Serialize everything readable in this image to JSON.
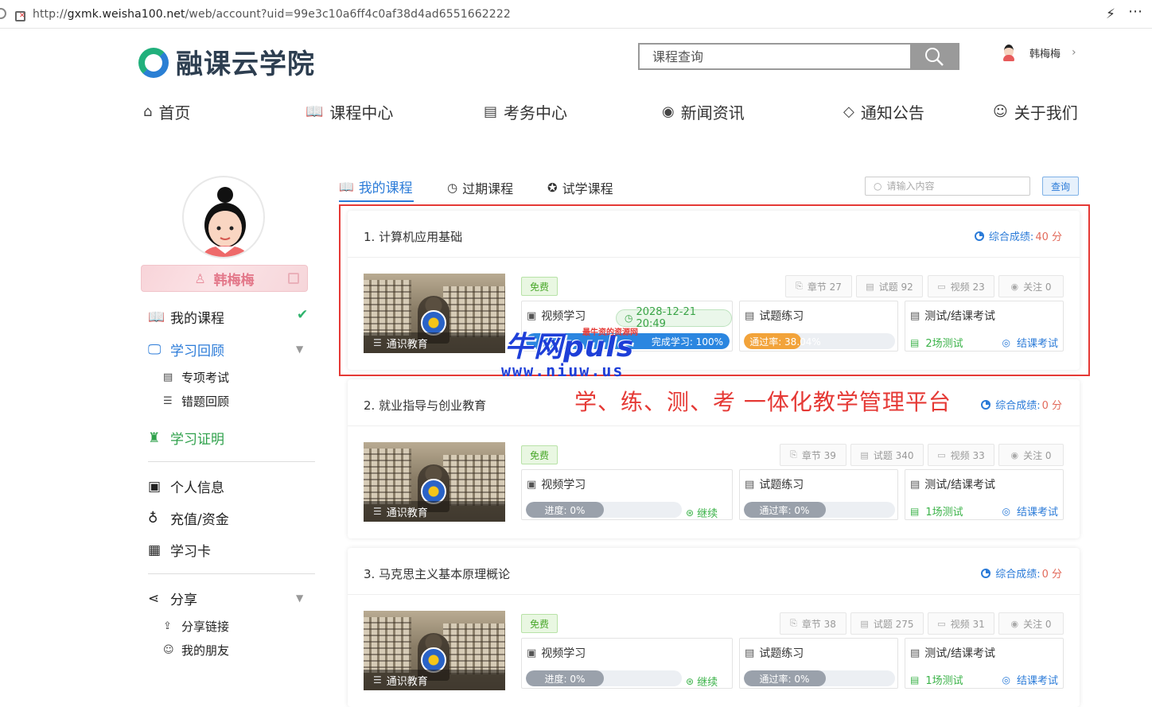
{
  "address_bar": {
    "url_prefix": "http://",
    "url_host": "gxmk.weisha100.net",
    "url_path": "/web/account?uid=99e3c10a6ff4c0af38d4ad6551662222"
  },
  "header": {
    "logo_text": "融课云学院",
    "search_placeholder": "课程查询",
    "user_name": "韩梅梅"
  },
  "nav": [
    {
      "label": "首页",
      "icon": "home-icon"
    },
    {
      "label": "课程中心",
      "icon": "book-icon"
    },
    {
      "label": "考务中心",
      "icon": "exam-icon"
    },
    {
      "label": "新闻资讯",
      "icon": "news-icon"
    },
    {
      "label": "通知公告",
      "icon": "tag-icon"
    },
    {
      "label": "关于我们",
      "icon": "users-icon"
    }
  ],
  "sidebar": {
    "user_name": "韩梅梅",
    "items": {
      "my_courses": "我的课程",
      "review": "学习回顾",
      "special_exam": "专项考试",
      "wrong_review": "错题回顾",
      "certificate": "学习证明",
      "profile": "个人信息",
      "recharge": "充值/资金",
      "study_card": "学习卡",
      "share": "分享",
      "share_link": "分享链接",
      "friends": "我的朋友"
    }
  },
  "tabs": {
    "my_courses": "我的课程",
    "expired": "过期课程",
    "trial": "试学课程",
    "search_placeholder": "请输入内容",
    "search_button": "查询"
  },
  "courses": [
    {
      "title": "1. 计算机应用基础",
      "score_label": "综合成绩:",
      "score": "40 分",
      "category": "通识教育",
      "free": "免费",
      "chapters": "章节 27",
      "questions": "试题 92",
      "videos": "视频 23",
      "follow": "关注 0",
      "video_label": "视频学习",
      "video_date": "2028-12-21 20:49",
      "video_progress_text": "完成学习: 100%",
      "video_progress": 1.0,
      "practice_label": "试题练习",
      "pass_text": "通过率: 38.04%",
      "pass_rate": 0.3804,
      "test_label": "测试/结课考试",
      "tests": "2场测试",
      "exam": "结课考试"
    },
    {
      "title": "2. 就业指导与创业教育",
      "score_label": "综合成绩:",
      "score": "0 分",
      "category": "通识教育",
      "free": "免费",
      "chapters": "章节 39",
      "questions": "试题 340",
      "videos": "视频 33",
      "follow": "关注 0",
      "video_label": "视频学习",
      "video_progress_text": "进度: 0%",
      "video_progress": 0,
      "continue": "继续",
      "practice_label": "试题练习",
      "pass_text": "通过率: 0%",
      "pass_rate": 0,
      "test_label": "测试/结课考试",
      "tests": "1场测试",
      "exam": "结课考试"
    },
    {
      "title": "3. 马克思主义基本原理概论",
      "score_label": "综合成绩:",
      "score": "0 分",
      "category": "通识教育",
      "free": "免费",
      "chapters": "章节 38",
      "questions": "试题 275",
      "videos": "视频 31",
      "follow": "关注 0",
      "video_label": "视频学习",
      "video_progress_text": "进度: 0%",
      "video_progress": 0,
      "continue": "继续",
      "practice_label": "试题练习",
      "pass_text": "通过率: 0%",
      "pass_rate": 0,
      "test_label": "测试/结课考试",
      "tests": "1场测试",
      "exam": "结课考试"
    }
  ],
  "overlay": {
    "watermark_big": "牛网puls",
    "watermark_small": "最牛资的资源网",
    "watermark_url": "www.niuw.us",
    "slogan": "学、练、测、考 一体化教学管理平台"
  },
  "colors": {
    "accent": "#2b7bd8",
    "success": "#3cb34a",
    "score": "#e26a5b",
    "highlight": "#e53935"
  }
}
